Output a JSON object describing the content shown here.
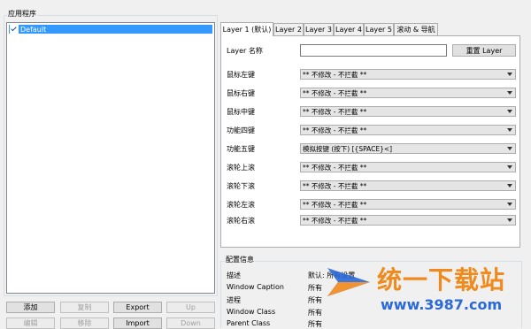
{
  "app_group": {
    "title": "应用程序",
    "items": [
      {
        "label": "Default",
        "checked": true
      }
    ]
  },
  "left_buttons": {
    "add": "添加",
    "copy": "复制",
    "export": "Export",
    "up": "Up",
    "edit": "编辑",
    "delete": "移除",
    "import": "Import",
    "down": "Down"
  },
  "tabs": [
    "Layer 1 (默认)",
    "Layer 2",
    "Layer 3",
    "Layer 4",
    "Layer 5",
    "滚动 & 导航"
  ],
  "layer": {
    "name_label": "Layer 名称",
    "name_value": "",
    "reset_button": "重置 Layer",
    "rows": [
      {
        "label": "鼠标左键",
        "value": "** 不修改 - 不拦截 **"
      },
      {
        "label": "鼠标右键",
        "value": "** 不修改 - 不拦截 **"
      },
      {
        "label": "鼠标中键",
        "value": "** 不修改 - 不拦截 **"
      },
      {
        "label": "功能四键",
        "value": "** 不修改 - 不拦截 **"
      },
      {
        "label": "功能五键",
        "value": "模拟按键 (按下) [{SPACE}<]"
      },
      {
        "label": "滚轮上滚",
        "value": "** 不修改 - 不拦截 **"
      },
      {
        "label": "滚轮下滚",
        "value": "** 不修改 - 不拦截 **"
      },
      {
        "label": "滚轮左滚",
        "value": "** 不修改 - 不拦截 **"
      },
      {
        "label": "滚轮右滚",
        "value": "** 不修改 - 不拦截 **"
      }
    ]
  },
  "config_info": {
    "title": "配置信息",
    "rows": [
      {
        "key": "描述",
        "value": "默认: 所有设置"
      },
      {
        "key": "Window Caption",
        "value": "所有"
      },
      {
        "key": "进程",
        "value": "所有"
      },
      {
        "key": "Window Class",
        "value": "所有"
      },
      {
        "key": "Parent Class",
        "value": "所有"
      }
    ]
  },
  "watermark": {
    "brand": "统一下载站",
    "url": "www.3987.com",
    "color_blue": "#2a6ad8",
    "color_orange": "#f08a1c"
  },
  "colors": {
    "selection": "#3399ff",
    "panel": "#ffffff",
    "window": "#f0f0f0"
  }
}
